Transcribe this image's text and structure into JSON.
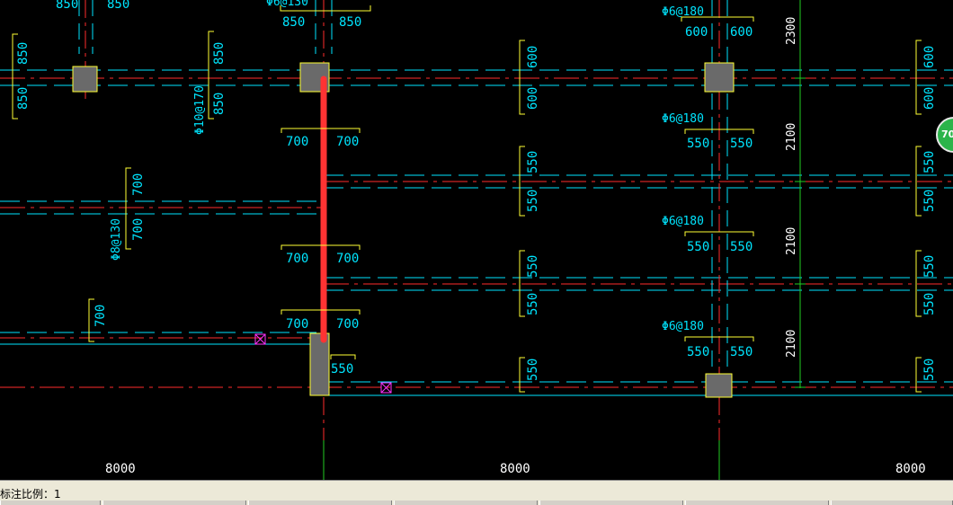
{
  "colors": {
    "background": "#000000",
    "axis_line": "#ff2b2b",
    "cyan": "#00e5ff",
    "dim_yellow": "#ffff33",
    "green": "#22cc22",
    "column_fill": "#6a6a6a",
    "highlight": "#ff3333",
    "magenta": "#ff33ff"
  },
  "status": {
    "scale_label": "标注比例：1"
  },
  "badge": {
    "text": "70"
  },
  "labels": {
    "dim_850": "850",
    "dim_700": "700",
    "dim_600": "600",
    "dim_550": "550",
    "span_8000": "8000",
    "v_2300": "2300",
    "v_2100": "2100",
    "rebar_180": "Φ6@180",
    "rebar_130_partial": "Φ6@130",
    "rebar_170": "Φ10@170",
    "rebar_8_130": "Φ8@130"
  }
}
